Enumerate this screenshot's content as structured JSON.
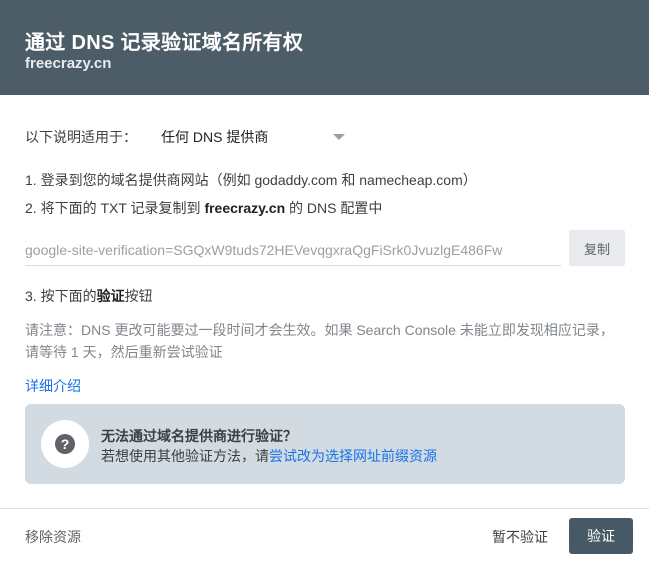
{
  "header": {
    "title": "通过 DNS 记录验证域名所有权",
    "domain": "freecrazy.cn"
  },
  "provider": {
    "label": "以下说明适用于：",
    "selected": "任何 DNS 提供商"
  },
  "steps": {
    "step1": "1. 登录到您的域名提供商网站（例如 godaddy.com 和 namecheap.com）",
    "step2_prefix": "2. 将下面的 TXT 记录复制到 ",
    "step2_domain": "freecrazy.cn",
    "step2_suffix": " 的 DNS 配置中",
    "step3_prefix": "3. 按下面的",
    "step3_bold": "验证",
    "step3_suffix": "按钮"
  },
  "txt_record": {
    "value": "google-site-verification=SGQxW9tuds72HEVevqgxraQgFiSrk0JvuzlgE486Fw",
    "copy_label": "复制"
  },
  "note": "请注意：DNS 更改可能要过一段时间才会生效。如果 Search Console 未能立即发现相应记录，请等待 1 天，然后重新尝试验证",
  "learn_more": "详细介绍",
  "alternative": {
    "icon_glyph": "?",
    "title": "无法通过域名提供商进行验证？",
    "desc_prefix": "若想使用其他验证方法，请",
    "desc_link": "尝试改为选择网址前缀资源"
  },
  "footer": {
    "remove": "移除资源",
    "skip": "暂不验证",
    "verify": "验证"
  },
  "colors": {
    "header_bg": "#4d5d68",
    "accent_link": "#1a73e8",
    "primary_button": "#455a64",
    "info_box_bg": "#d2dbe2"
  }
}
